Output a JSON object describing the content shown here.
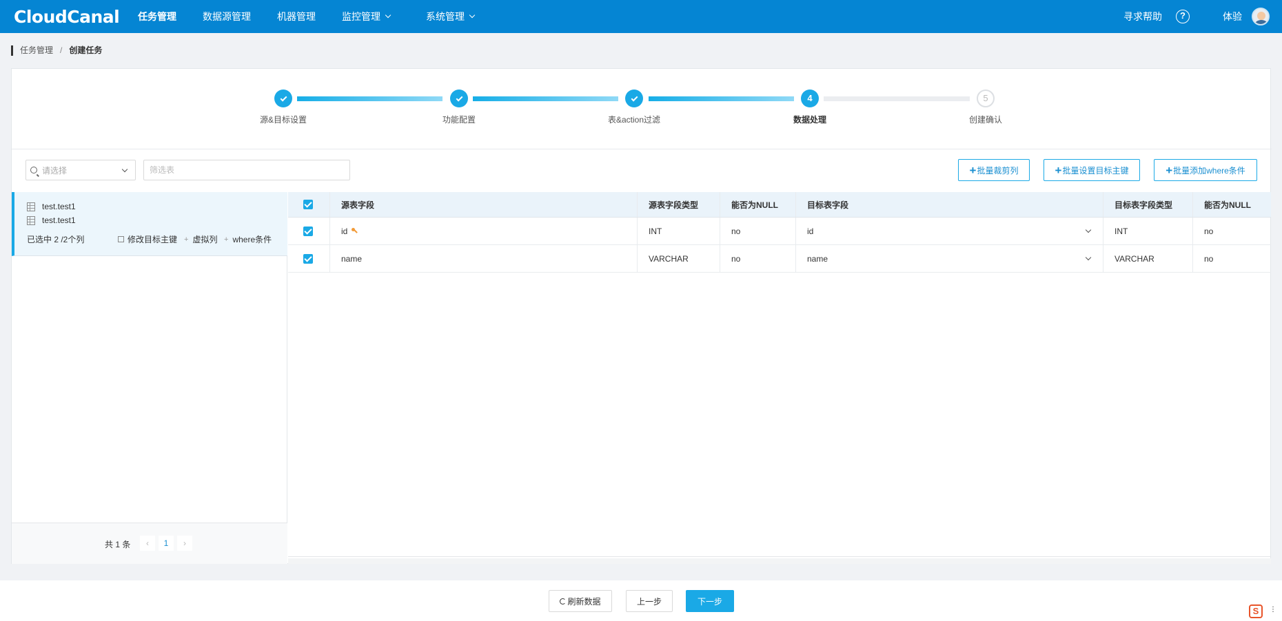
{
  "header": {
    "logo": "CloudCanal",
    "nav": [
      {
        "label": "任务管理"
      },
      {
        "label": "数据源管理"
      },
      {
        "label": "机器管理"
      },
      {
        "label": "监控管理"
      },
      {
        "label": "系统管理"
      }
    ],
    "help_label": "寻求帮助",
    "help_icon": "?",
    "user_name": "体验"
  },
  "breadcrumb": {
    "root": "任务管理",
    "separator": "/",
    "current": "创建任务"
  },
  "steps": [
    {
      "label": "源&目标设置",
      "status": "done"
    },
    {
      "label": "功能配置",
      "status": "done"
    },
    {
      "label": "表&action过滤",
      "status": "done"
    },
    {
      "label": "数据处理",
      "status": "active",
      "number": "4"
    },
    {
      "label": "创建确认",
      "status": "pending",
      "number": "5"
    }
  ],
  "filters": {
    "select_placeholder": "请选择",
    "table_filter_placeholder": "筛选表"
  },
  "actions": {
    "batch_trim": "批量裁剪列",
    "batch_pk": "批量设置目标主键",
    "batch_where": "批量添加where条件"
  },
  "task_list": {
    "items": [
      {
        "source_table": "test.test1",
        "target_table": "test.test1",
        "selected": "已选中 2 /2个列",
        "modify_pk": "修改目标主键",
        "virtual_col": "虚拟列",
        "where_cond": "where条件"
      }
    ],
    "pager": {
      "total": "共 1 条",
      "current_page": "1",
      "prev": "‹",
      "next": "›"
    }
  },
  "columns_table": {
    "headers": {
      "source_field": "源表字段",
      "source_type": "源表字段类型",
      "source_nullable": "能否为NULL",
      "target_field": "目标表字段",
      "target_type": "目标表字段类型",
      "target_nullable": "能否为NULL"
    },
    "rows": [
      {
        "source_field": "id",
        "is_primary_key": true,
        "source_type": "INT",
        "source_nullable": "no",
        "target_field": "id",
        "target_type": "INT",
        "target_nullable": "no"
      },
      {
        "source_field": "name",
        "is_primary_key": false,
        "source_type": "VARCHAR",
        "source_nullable": "no",
        "target_field": "name",
        "target_type": "VARCHAR",
        "target_nullable": "no"
      }
    ]
  },
  "footer": {
    "refresh": "刷新数据",
    "prev": "上一步",
    "next": "下一步"
  },
  "colors": {
    "brand": "#0585d3",
    "accent": "#1aa9e6"
  }
}
